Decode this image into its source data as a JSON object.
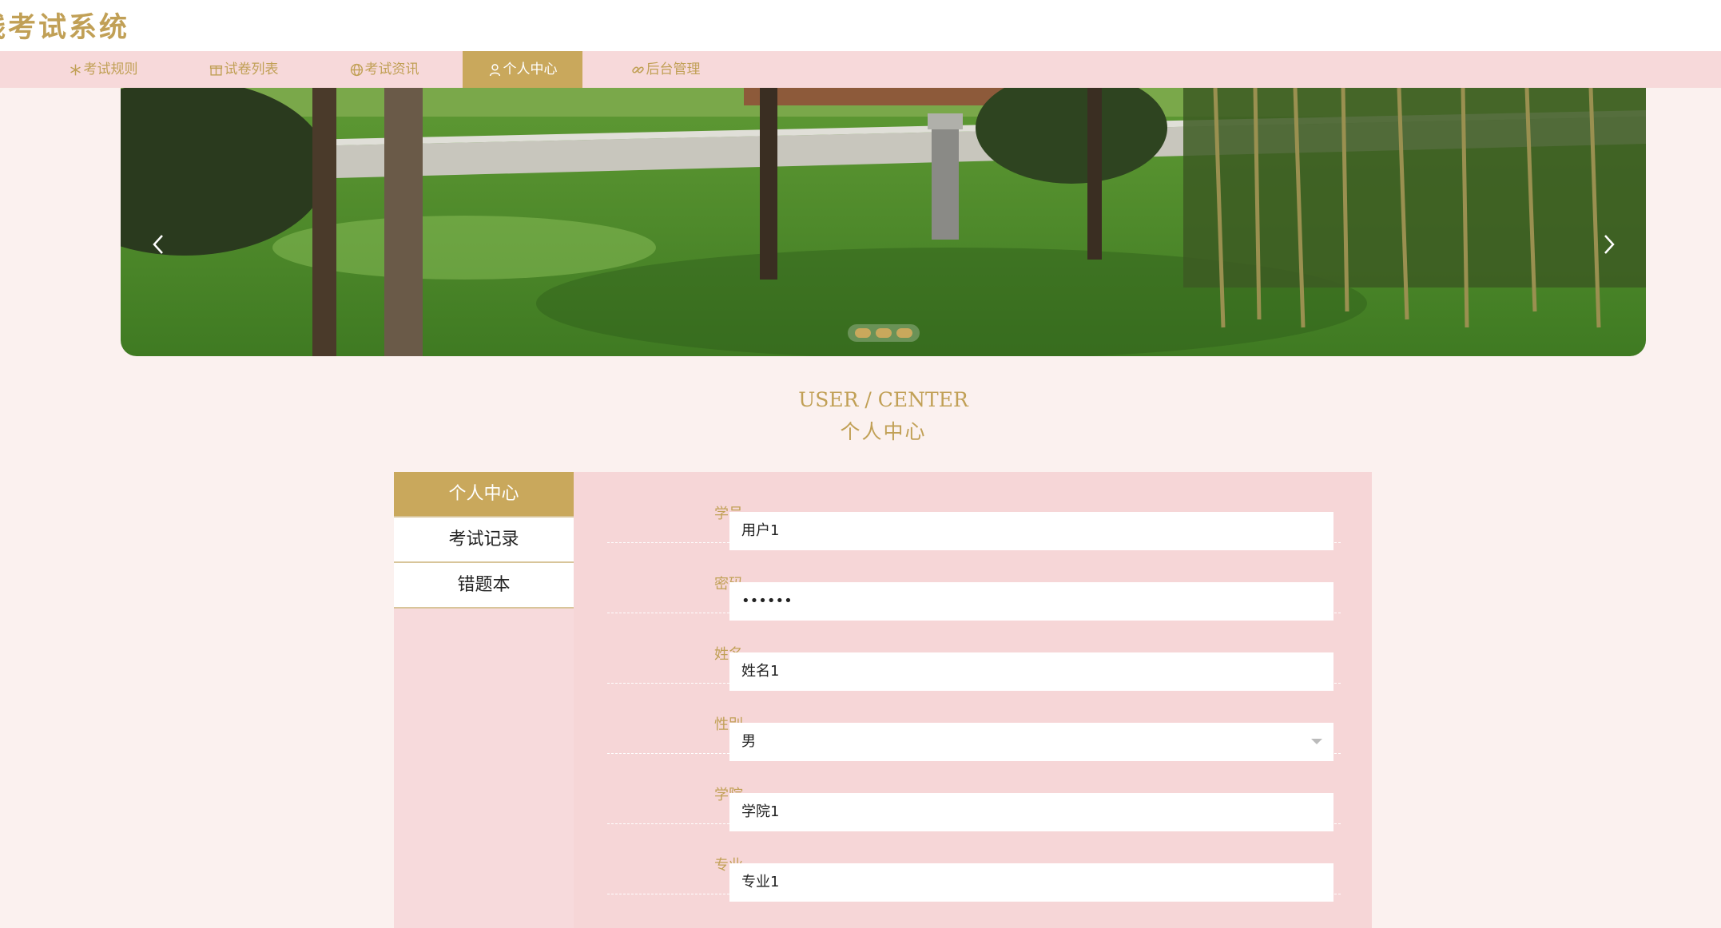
{
  "site": {
    "title": "线考试系统"
  },
  "nav": {
    "items": [
      {
        "label": "考试规则",
        "icon": "snowflake-icon"
      },
      {
        "label": "试卷列表",
        "icon": "gift-icon"
      },
      {
        "label": "考试资讯",
        "icon": "globe-icon"
      },
      {
        "label": "个人中心",
        "icon": "user-icon",
        "active": true
      },
      {
        "label": "后台管理",
        "icon": "link-icon"
      }
    ]
  },
  "banner": {
    "slide_count": 3,
    "active_slide": 1
  },
  "section": {
    "title_en": "USER / CENTER",
    "title_cn": "个人中心"
  },
  "sidemenu": {
    "items": [
      {
        "label": "个人中心",
        "active": true
      },
      {
        "label": "考试记录"
      },
      {
        "label": "错题本"
      }
    ]
  },
  "form": {
    "fields": [
      {
        "label": "学号",
        "value": "用户1"
      },
      {
        "label": "密码",
        "value": "••••••"
      },
      {
        "label": "姓名",
        "value": "姓名1"
      },
      {
        "label": "性别",
        "value": "男"
      },
      {
        "label": "学院",
        "value": "学院1"
      },
      {
        "label": "专业",
        "value": "专业1"
      }
    ]
  },
  "colors": {
    "accent": "#c9a85c",
    "nav_bg": "#f7d9da",
    "page_bg": "#fbf1ef",
    "panel_bg": "#f6d6d7"
  }
}
